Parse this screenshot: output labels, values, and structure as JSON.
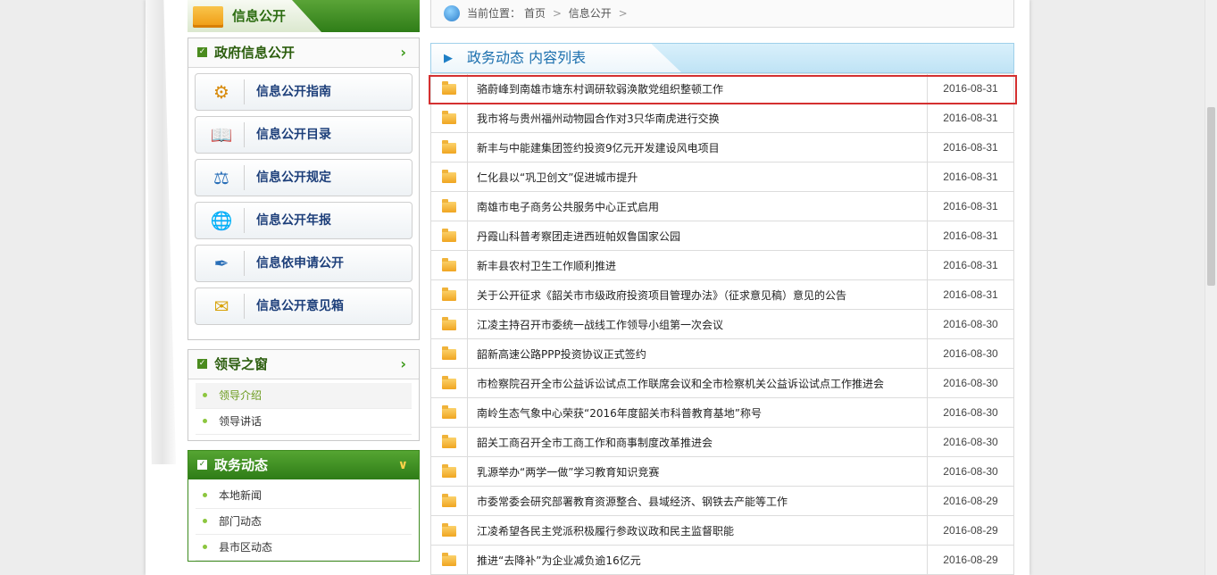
{
  "left": {
    "section_title": "信息公开",
    "gov_box": {
      "title": "政府信息公开",
      "buttons": [
        {
          "label": "信息公开指南",
          "icon": "gear-folder-icon"
        },
        {
          "label": "信息公开目录",
          "icon": "book-icon"
        },
        {
          "label": "信息公开规定",
          "icon": "rules-icon"
        },
        {
          "label": "信息公开年报",
          "icon": "globe-report-icon"
        },
        {
          "label": "信息依申请公开",
          "icon": "stamp-icon"
        },
        {
          "label": "信息公开意见箱",
          "icon": "mail-icon"
        }
      ]
    },
    "leader_box": {
      "title": "领导之窗",
      "items": [
        "领导介绍",
        "领导讲话"
      ]
    },
    "gov_affairs_box": {
      "title": "政务动态",
      "items": [
        "本地新闻",
        "部门动态",
        "县市区动态"
      ]
    }
  },
  "breadcrumb": {
    "prefix": "当前位置：",
    "home": "首页",
    "sep": ">",
    "current": "信息公开"
  },
  "list": {
    "title": "政务动态 内容列表",
    "rows": [
      {
        "title": "骆蔚峰到南雄市塘东村调研软弱涣散党组织整顿工作",
        "date": "2016-08-31"
      },
      {
        "title": "我市将与贵州福州动物园合作对3只华南虎进行交换",
        "date": "2016-08-31"
      },
      {
        "title": "新丰与中能建集团签约投资9亿元开发建设风电项目",
        "date": "2016-08-31"
      },
      {
        "title": "仁化县以“巩卫创文”促进城市提升",
        "date": "2016-08-31"
      },
      {
        "title": "南雄市电子商务公共服务中心正式启用",
        "date": "2016-08-31"
      },
      {
        "title": "丹霞山科普考察团走进西班帕奴鲁国家公园",
        "date": "2016-08-31"
      },
      {
        "title": "新丰县农村卫生工作顺利推进",
        "date": "2016-08-31"
      },
      {
        "title": "关于公开征求《韶关市市级政府投资项目管理办法》（征求意见稿）意见的公告",
        "date": "2016-08-31"
      },
      {
        "title": "江凌主持召开市委统一战线工作领导小组第一次会议",
        "date": "2016-08-30"
      },
      {
        "title": "韶新高速公路PPP投资协议正式签约",
        "date": "2016-08-30"
      },
      {
        "title": "市检察院召开全市公益诉讼试点工作联席会议和全市检察机关公益诉讼试点工作推进会",
        "date": "2016-08-30"
      },
      {
        "title": "南岭生态气象中心荣获“2016年度韶关市科普教育基地”称号",
        "date": "2016-08-30"
      },
      {
        "title": "韶关工商召开全市工商工作和商事制度改革推进会",
        "date": "2016-08-30"
      },
      {
        "title": "乳源举办“两学一做”学习教育知识竞赛",
        "date": "2016-08-30"
      },
      {
        "title": "市委常委会研究部署教育资源整合、县域经济、钢铁去产能等工作",
        "date": "2016-08-29"
      },
      {
        "title": "江凌希望各民主党派积极履行参政议政和民主监督职能",
        "date": "2016-08-29"
      },
      {
        "title": "推进“去降补”为企业减负逾16亿元",
        "date": "2016-08-29"
      }
    ]
  }
}
